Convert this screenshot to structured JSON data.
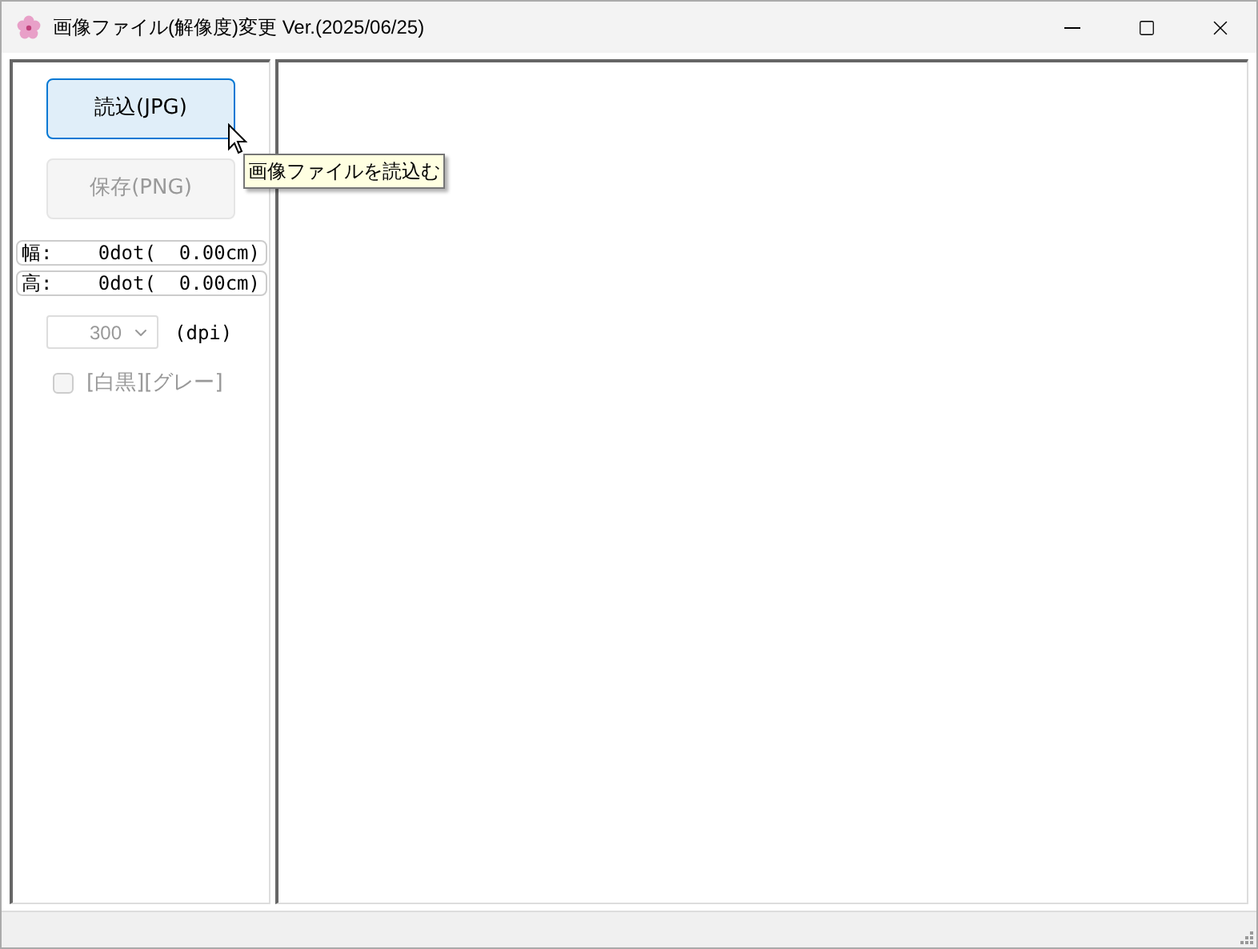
{
  "window": {
    "title": "画像ファイル(解像度)変更 Ver.(2025/06/25)"
  },
  "buttons": [
    {
      "label": "読込(JPG)",
      "disabled": false,
      "hovered": true
    },
    {
      "label": "保存(PNG)",
      "disabled": true,
      "hovered": false
    }
  ],
  "tooltip": {
    "text": "画像ファイルを読込む"
  },
  "size_fields": [
    {
      "label": "幅:",
      "value": "0dot(  0.00cm)"
    },
    {
      "label": "高:",
      "value": "0dot(  0.00cm)"
    }
  ],
  "dpi": {
    "value": "300",
    "disabled": true,
    "unit": "(dpi)"
  },
  "checkbox": {
    "label": "[白黒][グレー]",
    "checked": false,
    "disabled": true
  }
}
